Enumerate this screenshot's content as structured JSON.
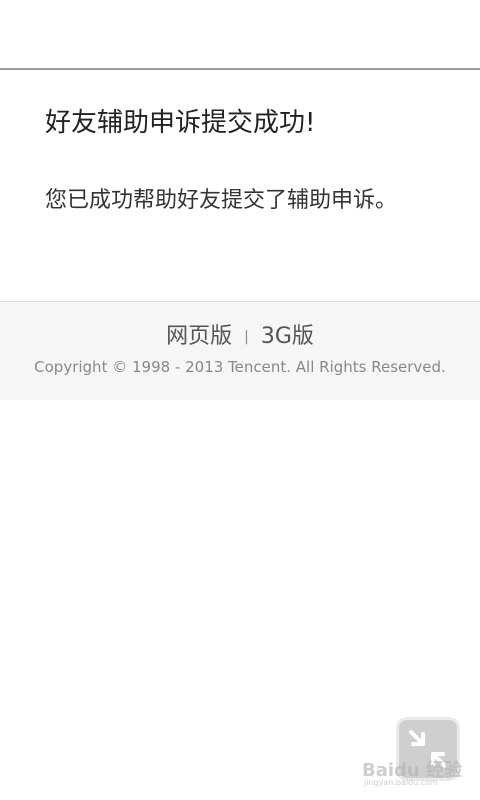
{
  "content": {
    "title": "好友辅助申诉提交成功!",
    "message": "您已成功帮助好友提交了辅助申诉。"
  },
  "footer": {
    "link_web": "网页版",
    "separator": "|",
    "link_3g": "3G版",
    "copyright": "Copyright © 1998 - 2013 Tencent. All Rights Reserved."
  },
  "widget": {
    "icon": "collapse-arrows-icon"
  },
  "watermark": {
    "brand": "Baidu 经验",
    "url": "jingyan.baidu.com"
  },
  "colors": {
    "divider": "#9e9e9e",
    "footer_bg": "#f6f6f6",
    "text_dark": "#222222",
    "text_muted": "#888888"
  }
}
